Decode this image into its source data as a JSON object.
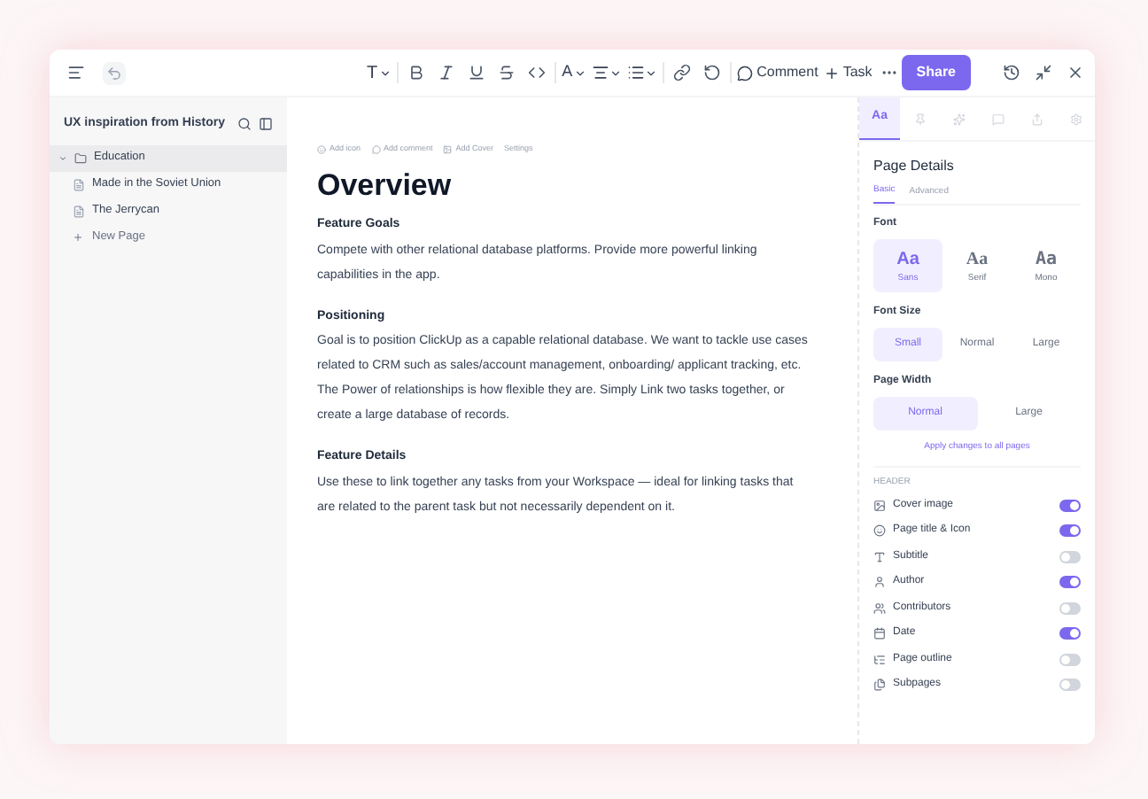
{
  "toolbar": {
    "text_style": "T",
    "font_color": "A",
    "comment": "Comment",
    "task": "Task",
    "share": "Share"
  },
  "sidebar": {
    "title": "UX inspiration from History",
    "items": [
      {
        "label": "Education",
        "selected": true,
        "expanded": true,
        "kind": "folder"
      },
      {
        "label": "Made in the Soviet Union",
        "selected": false,
        "kind": "page"
      },
      {
        "label": "The Jerrycan",
        "selected": false,
        "kind": "page"
      }
    ],
    "new_page": "New Page"
  },
  "document": {
    "actions": [
      "Add icon",
      "Add comment",
      "Add Cover",
      "Settings"
    ],
    "title": "Overview",
    "sections": [
      {
        "heading": "Feature Goals",
        "paragraphs": [
          "Compete with other relational database platforms. Provide more powerful linking capabilities in the app."
        ]
      },
      {
        "heading": "Positioning",
        "paragraphs": [
          "Goal is to position ClickUp as a capable relational database. We want to tackle use cases related to CRM such as sales/account management, onboarding/ applicant tracking, etc.",
          "The Power of relationships is how flexible they are. Simply Link two tasks together, or create a large database of records."
        ]
      },
      {
        "heading": "Feature Details",
        "paragraphs": [
          "Use these to link together any tasks from your Workspace — ideal for linking tasks that are related to the parent task but not necessarily dependent on it."
        ]
      }
    ]
  },
  "panel": {
    "tab_label": "Aa",
    "title": "Page Details",
    "tabs": [
      {
        "label": "Basic",
        "selected": true
      },
      {
        "label": "Advanced",
        "selected": false
      }
    ],
    "font_label": "Font",
    "fonts": [
      {
        "sample": "Aa",
        "label": "Sans",
        "selected": true,
        "kind": "sans"
      },
      {
        "sample": "Aa",
        "label": "Serif",
        "selected": false,
        "kind": "serif"
      },
      {
        "sample": "Aa",
        "label": "Mono",
        "selected": false,
        "kind": "mono"
      }
    ],
    "font_size_label": "Font Size",
    "font_sizes": [
      {
        "label": "Small",
        "selected": true
      },
      {
        "label": "Normal",
        "selected": false
      },
      {
        "label": "Large",
        "selected": false
      }
    ],
    "page_width_label": "Page Width",
    "page_widths": [
      {
        "label": "Normal",
        "selected": true
      },
      {
        "label": "Large",
        "selected": false
      }
    ],
    "apply_link": "Apply changes to all pages",
    "header_label": "HEADER",
    "toggles": [
      {
        "label": "Cover image",
        "on": true,
        "kind": "image"
      },
      {
        "label": "Page title & Icon",
        "on": true,
        "kind": "smile"
      },
      {
        "label": "Subtitle",
        "on": false,
        "kind": "type"
      },
      {
        "label": "Author",
        "on": true,
        "kind": "user"
      },
      {
        "label": "Contributors",
        "on": false,
        "kind": "users"
      },
      {
        "label": "Date",
        "on": true,
        "kind": "calendar"
      },
      {
        "label": "Page outline",
        "on": false,
        "kind": "outline"
      },
      {
        "label": "Subpages",
        "on": false,
        "kind": "pages"
      }
    ]
  }
}
